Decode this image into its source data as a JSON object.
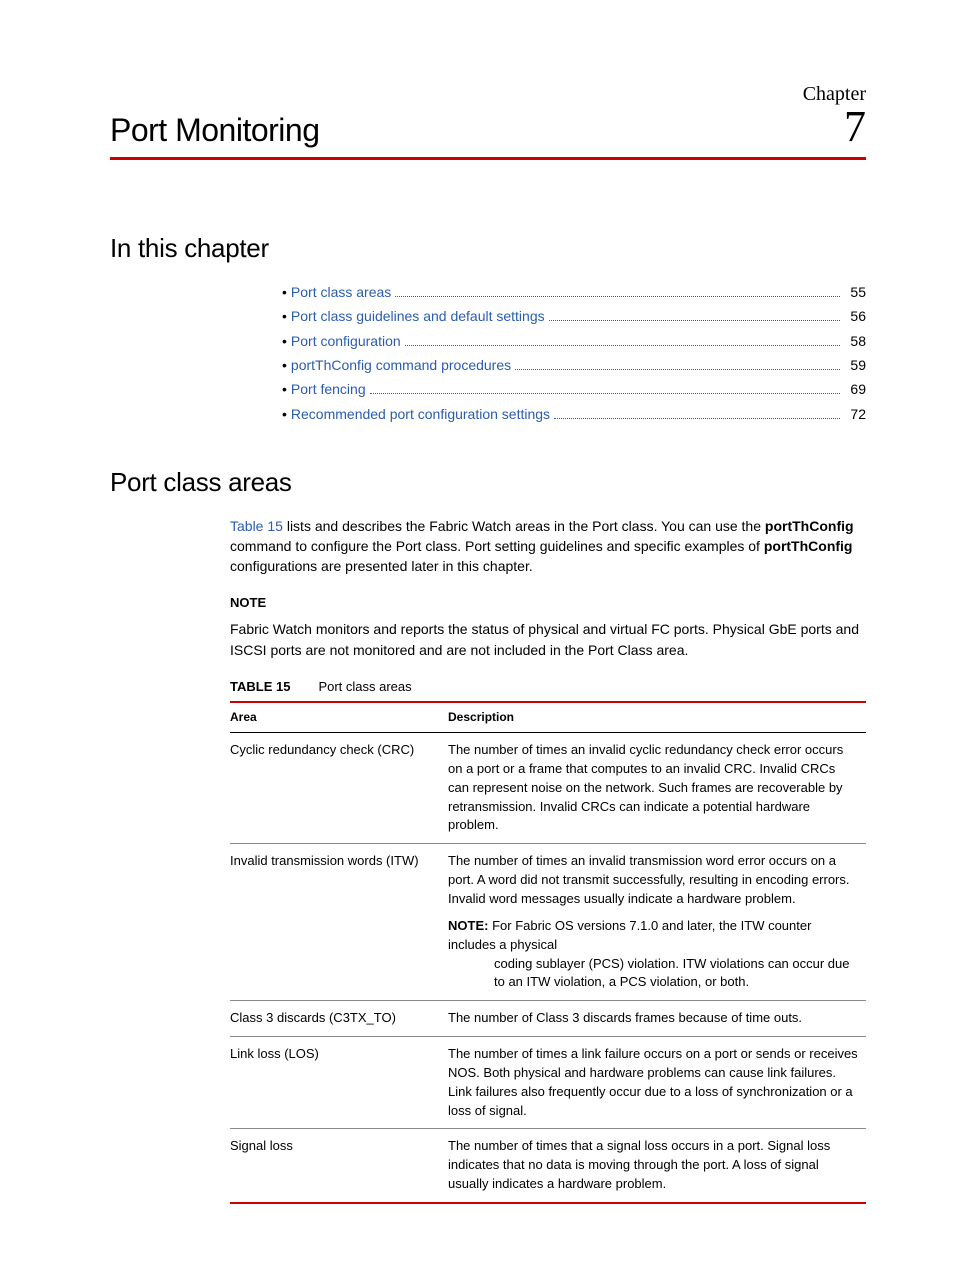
{
  "chapter": {
    "label": "Chapter",
    "title": "Port Monitoring",
    "number": "7"
  },
  "toc": {
    "heading": "In this chapter",
    "items": [
      {
        "label": "Port class areas",
        "page": "55"
      },
      {
        "label": "Port class guidelines and default settings",
        "page": "56"
      },
      {
        "label": "Port configuration",
        "page": "58"
      },
      {
        "label": "portThConfig command procedures",
        "page": "59"
      },
      {
        "label": "Port fencing",
        "page": "69"
      },
      {
        "label": "Recommended port configuration settings",
        "page": "72"
      }
    ]
  },
  "section": {
    "heading": "Port class areas",
    "intro_link": "Table 15",
    "intro_after_link": " lists and describes the Fabric Watch areas in the Port class. You can use the ",
    "intro_cmd1": "portThConfig",
    "intro_after_cmd1": " command to configure the Port class. Port setting guidelines and specific examples of ",
    "intro_cmd2": "portThConfig",
    "intro_tail": " configurations are presented later in this chapter.",
    "note_head": "NOTE",
    "note_body": "Fabric Watch monitors and reports the status of physical and virtual FC ports. Physical GbE ports and ISCSI ports are not monitored and are not included in the Port Class area."
  },
  "table": {
    "label": "TABLE 15",
    "caption": "Port class areas",
    "headers": {
      "area": "Area",
      "desc": "Description"
    },
    "rows": [
      {
        "area": "Cyclic redundancy check (CRC)",
        "desc": "The number of times an invalid cyclic redundancy check error occurs on a port or a frame that computes to an invalid CRC. Invalid CRCs can represent noise on the network. Such frames are recoverable by retransmission. Invalid CRCs can indicate a potential hardware problem.",
        "note_label": "",
        "note_first": "",
        "note_rest": ""
      },
      {
        "area": "Invalid transmission words (ITW)",
        "desc": "The number of times an invalid transmission word error occurs on a port. A word did not transmit successfully, resulting in encoding errors. Invalid word messages usually indicate a hardware problem.",
        "note_label": "NOTE:",
        "note_first": "For Fabric OS versions 7.1.0 and later, the ITW counter includes a physical",
        "note_rest": "coding sublayer (PCS) violation. ITW violations can occur due to an ITW violation, a PCS violation, or both."
      },
      {
        "area": "Class 3 discards (C3TX_TO)",
        "desc": "The number of Class 3 discards frames because of time outs.",
        "note_label": "",
        "note_first": "",
        "note_rest": ""
      },
      {
        "area": "Link loss (LOS)",
        "desc": "The number of times a link failure occurs on a port or sends or receives NOS. Both physical and hardware problems can cause link failures. Link failures also frequently occur due to a loss of synchronization or a loss of signal.",
        "note_label": "",
        "note_first": "",
        "note_rest": ""
      },
      {
        "area": "Signal loss",
        "desc": "The number of times that a signal loss occurs in a port. Signal loss indicates that no data is moving through the port. A loss of signal usually indicates a hardware problem.",
        "note_label": "",
        "note_first": "",
        "note_rest": ""
      }
    ]
  }
}
